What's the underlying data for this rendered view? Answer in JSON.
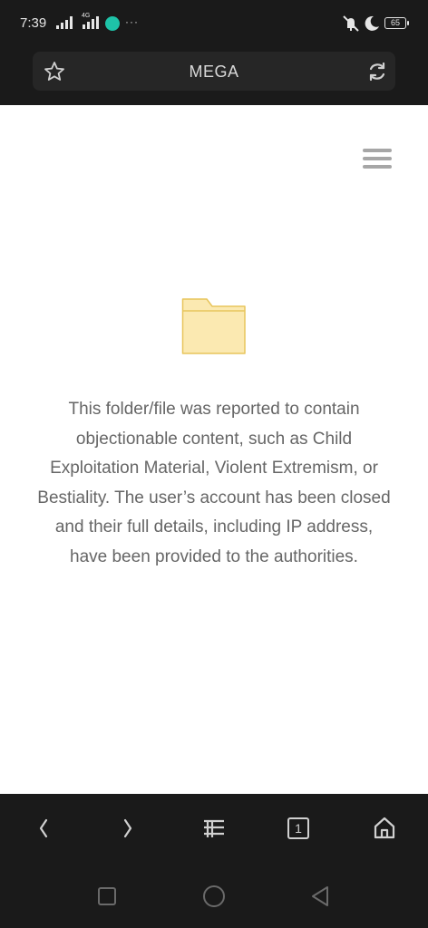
{
  "status_bar": {
    "time": "7:39",
    "network_label": "4G",
    "more_indicator": "···",
    "battery": "65",
    "icons": [
      "signal-icon",
      "signal-4g-icon",
      "app-notification-icon",
      "vibrate-mute-icon",
      "moon-icon",
      "battery-icon"
    ]
  },
  "browser": {
    "title": "MEGA",
    "icons": [
      "star-icon",
      "reload-icon"
    ]
  },
  "page": {
    "menu_icon": "hamburger-menu-icon",
    "folder_icon": "folder-icon",
    "message": "This folder/file was reported to contain objectionable content, such as Child Exploitation Material, Violent Extremism, or Bestiality. The user’s account has been closed and their full details, including IP address, have been provided to the authorities."
  },
  "bottom_nav": {
    "tab_count": "1",
    "icons": [
      "back-icon",
      "forward-icon",
      "menu-lines-icon",
      "tabs-icon",
      "home-icon"
    ]
  },
  "system_nav": {
    "icons": [
      "recents-square-icon",
      "home-circle-icon",
      "back-triangle-icon"
    ]
  },
  "colors": {
    "chrome_background": "#1a1a1a",
    "url_box": "#262626",
    "page_background": "#ffffff",
    "message_text": "#666666",
    "folder_fill": "#fbe9b1",
    "folder_stroke": "#e8c55c"
  }
}
